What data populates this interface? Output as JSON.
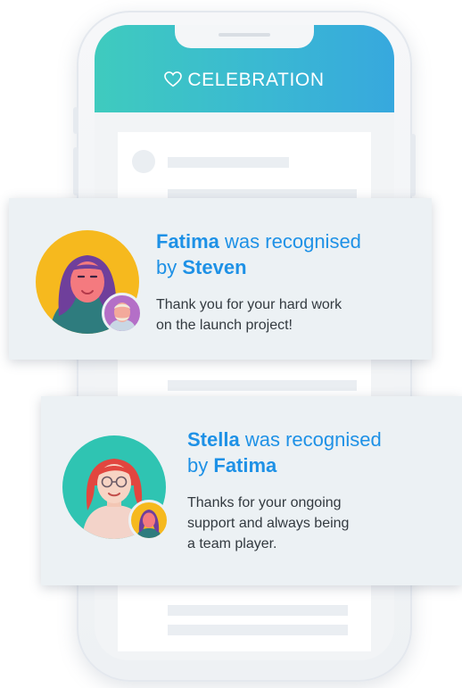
{
  "header": {
    "title": "CELEBRATION",
    "icon": "heart-icon",
    "gradient": [
      "#3fcbbe",
      "#37a8de"
    ]
  },
  "recognitions": [
    {
      "recipient": "Fatima",
      "phrase": "was recognised",
      "by_word": "by",
      "giver": "Steven",
      "message_lines": [
        "Thank you for your hard work",
        "on the launch project!"
      ]
    },
    {
      "recipient": "Stella",
      "phrase": "was recognised",
      "by_word": "by",
      "giver": "Fatima",
      "message_lines": [
        "Thanks for your ongoing",
        "support and always being",
        "a team player."
      ]
    }
  ],
  "colors": {
    "accent": "#1e91e6",
    "card_bg": "#ecf1f4",
    "text": "#333a40"
  }
}
